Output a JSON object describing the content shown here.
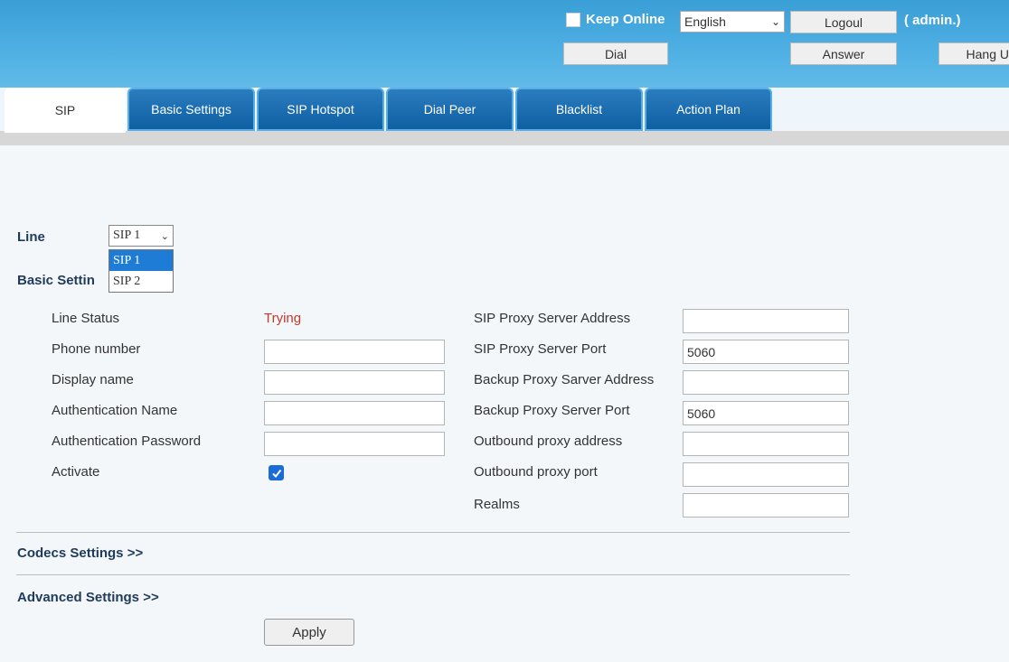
{
  "header": {
    "keep_online_label": "Keep Online",
    "language_value": "English",
    "logout_label": "Logoul",
    "admin_label": "( admin.)",
    "dial_label": "Dial",
    "answer_label": "Answer",
    "hangup_label": "Hang U"
  },
  "tabs": [
    {
      "label": "SIP",
      "active": true
    },
    {
      "label": "Basic Settings",
      "active": false
    },
    {
      "label": "SIP Hotspot",
      "active": false
    },
    {
      "label": "Dial Peer",
      "active": false
    },
    {
      "label": "Blacklist",
      "active": false
    },
    {
      "label": "Action Plan",
      "active": false
    }
  ],
  "line": {
    "label": "Line",
    "selected": "SIP 1",
    "options": [
      "SIP 1",
      "SIP 2"
    ]
  },
  "basic_settings": {
    "title": "Basic Settin",
    "left": [
      {
        "label": "Line Status",
        "value": "Trying"
      },
      {
        "label": "Phone number",
        "value": ""
      },
      {
        "label": "Display name",
        "value": ""
      },
      {
        "label": "Authentication Name",
        "value": ""
      },
      {
        "label": "Authentication Password",
        "value": ""
      },
      {
        "label": "Activate",
        "checked": true
      }
    ],
    "right": [
      {
        "label": "SIP Proxy Server Address",
        "value": ""
      },
      {
        "label": "SIP Proxy Server Port",
        "value": "5060"
      },
      {
        "label": "Backup Proxy Sarver Address",
        "value": ""
      },
      {
        "label": "Backup Proxy Server Port",
        "value": "5060"
      },
      {
        "label": "Outbound proxy address",
        "value": ""
      },
      {
        "label": "Outbound proxy port",
        "value": ""
      },
      {
        "label": "Realms",
        "value": ""
      }
    ]
  },
  "sections": {
    "codecs": "Codecs Settings >>",
    "advanced": "Advanced Settings >>"
  },
  "apply_label": "Apply",
  "colors": {
    "header_blue": "#3a9fd6",
    "tab_blue": "#0f5fa3",
    "status_red": "#c0392b",
    "checkbox_blue": "#1a6cd6"
  }
}
